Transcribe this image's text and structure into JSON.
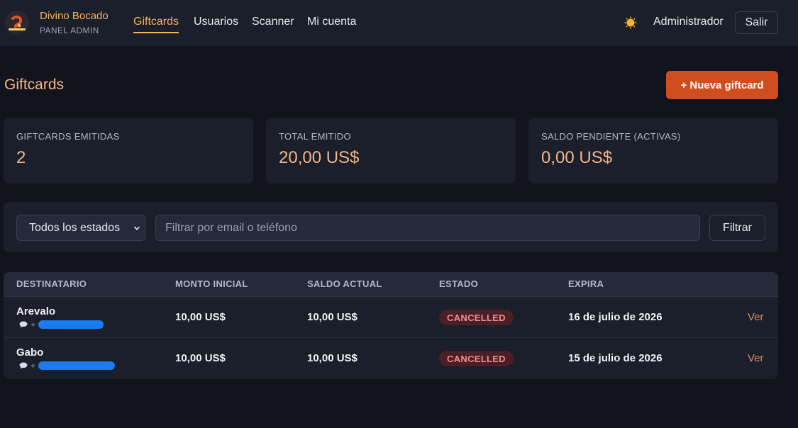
{
  "brand": {
    "name": "Divino Bocado",
    "subtitle": "PANEL ADMIN",
    "logo_text": "Divino Bocado"
  },
  "nav": {
    "links": [
      {
        "label": "Giftcards",
        "active": true
      },
      {
        "label": "Usuarios",
        "active": false
      },
      {
        "label": "Scanner",
        "active": false
      },
      {
        "label": "Mi cuenta",
        "active": false
      }
    ],
    "theme_icon": "sun-icon",
    "user": "Administrador",
    "logout_label": "Salir"
  },
  "page": {
    "title": "Giftcards",
    "new_button": "+ Nueva giftcard"
  },
  "stats": [
    {
      "label": "GIFTCARDS EMITIDAS",
      "value": "2"
    },
    {
      "label": "TOTAL EMITIDO",
      "value": "20,00 US$"
    },
    {
      "label": "SALDO PENDIENTE (ACTIVAS)",
      "value": "0,00 US$"
    }
  ],
  "filters": {
    "status_selected": "Todos los estados",
    "search_placeholder": "Filtrar por email o teléfono",
    "filter_button": "Filtrar"
  },
  "table": {
    "columns": [
      "DESTINATARIO",
      "MONTO INICIAL",
      "SALDO ACTUAL",
      "ESTADO",
      "EXPIRA"
    ],
    "rows": [
      {
        "name": "Arevalo",
        "phone_prefix": "+",
        "initial": "10,00 US$",
        "balance": "10,00 US$",
        "status": "CANCELLED",
        "expires": "16 de julio de 2026",
        "action": "Ver"
      },
      {
        "name": "Gabo",
        "phone_prefix": "+",
        "initial": "10,00 US$",
        "balance": "10,00 US$",
        "status": "CANCELLED",
        "expires": "15 de julio de 2026",
        "action": "Ver"
      }
    ]
  },
  "colors": {
    "accent": "#f3b358",
    "primary_button": "#d04e1e",
    "background": "#11131d",
    "card": "#1b1e2b",
    "badge_cancelled_bg": "#4a1f26",
    "badge_cancelled_text": "#f38c8c",
    "redaction": "#1a7cf0"
  }
}
